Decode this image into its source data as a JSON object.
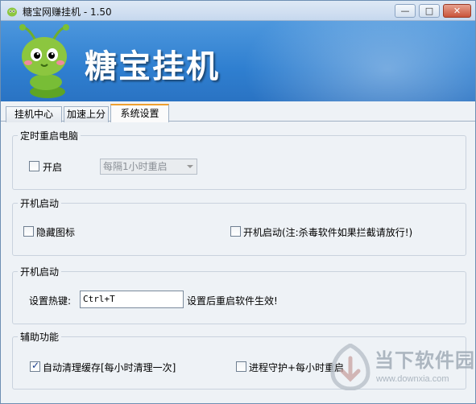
{
  "window": {
    "title": "糖宝网赚挂机 - 1.50"
  },
  "titlebar": {
    "minimize": "—",
    "maximize": "□",
    "close": "✕"
  },
  "banner": {
    "brand": "糖宝挂机"
  },
  "tabs": [
    {
      "label": "挂机中心"
    },
    {
      "label": "加速上分"
    },
    {
      "label": "系统设置"
    }
  ],
  "groups": {
    "restart": {
      "title": "定时重启电脑",
      "enable_label": "开启",
      "enable_checked": false,
      "interval_select": "每隔1小时重启"
    },
    "startup": {
      "title": "开机启动",
      "hide_icon_label": "隐藏图标",
      "hide_icon_checked": false,
      "autostart_label": "开机启动(注:杀毒软件如果拦截请放行!)",
      "autostart_checked": false
    },
    "hotkey": {
      "title": "开机启动",
      "label": "设置热键:",
      "value": "Ctrl+T",
      "note": "设置后重启软件生效!"
    },
    "helper": {
      "title": "辅助功能",
      "auto_clean_label": "自动清理缓存[每小时清理一次]",
      "auto_clean_checked": true,
      "guard_label": "进程守护+每小时重启",
      "guard_checked": false
    }
  },
  "watermark": {
    "text": "当下软件园",
    "url": "www.downxia.com"
  }
}
